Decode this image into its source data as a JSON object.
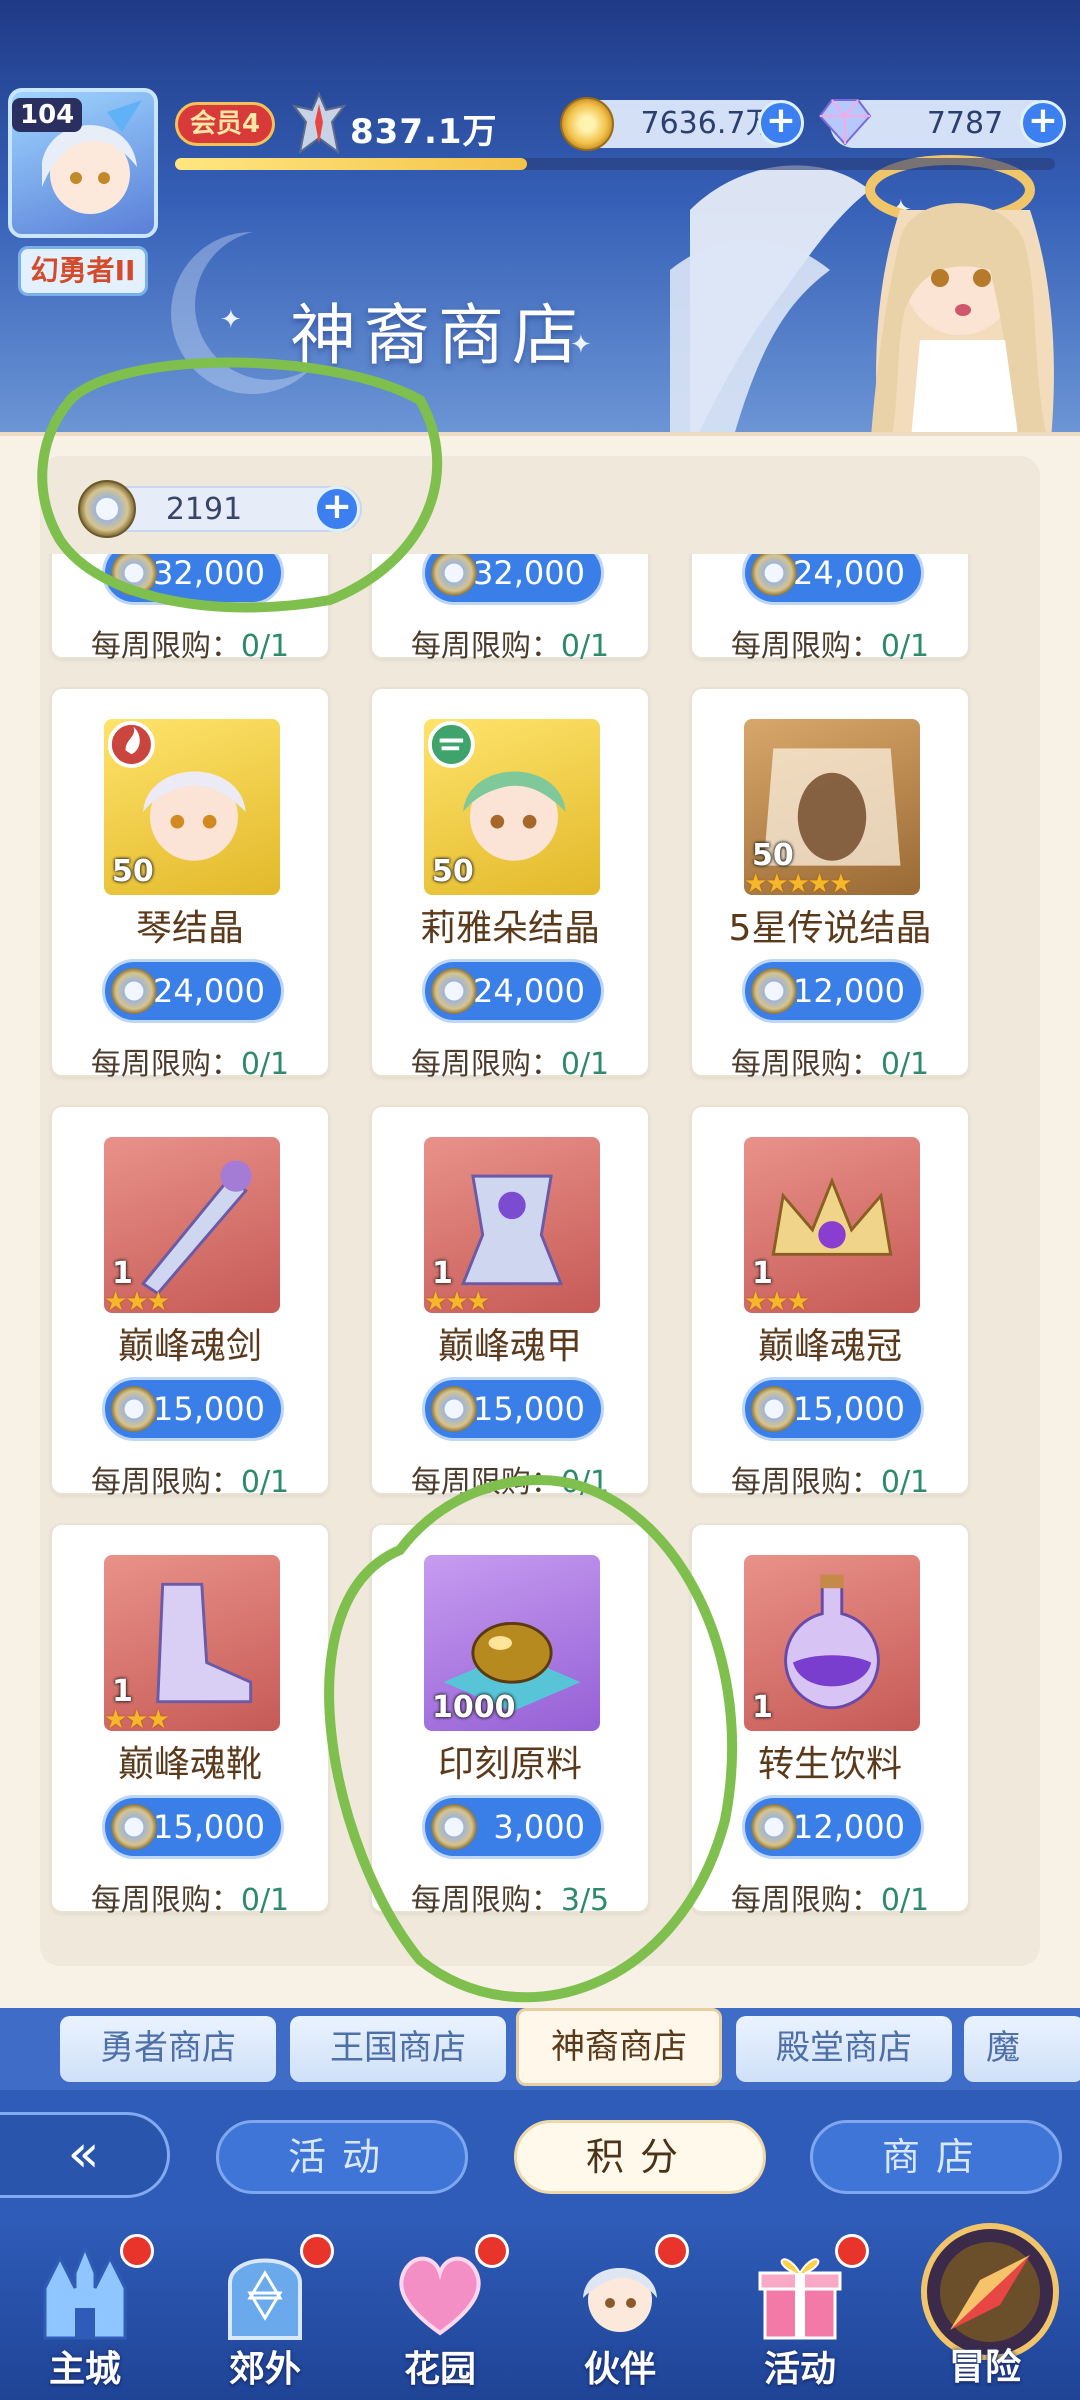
{
  "header": {
    "level": "104",
    "player_name": "幻勇者II",
    "vip": "会员4",
    "power": "837.1万",
    "gold": "7636.7万",
    "gems": "7787",
    "shop_title": "神裔商店",
    "exp_progress": 0.4
  },
  "currency": {
    "value": "2191"
  },
  "items": [
    {
      "name": "",
      "qty": "",
      "stars": 0,
      "price": "32,000",
      "limit_label": "每周限购：",
      "limit_value": "0/1",
      "thumb": "partial"
    },
    {
      "name": "",
      "qty": "",
      "stars": 0,
      "price": "32,000",
      "limit_label": "每周限购：",
      "limit_value": "0/1",
      "thumb": "partial"
    },
    {
      "name": "",
      "qty": "",
      "stars": 0,
      "price": "24,000",
      "limit_label": "每周限购：",
      "limit_value": "0/1",
      "thumb": "partial"
    },
    {
      "name": "琴结晶",
      "qty": "50",
      "stars": 0,
      "price": "24,000",
      "limit_label": "每周限购：",
      "limit_value": "0/1",
      "thumb": "gold-hero-red"
    },
    {
      "name": "莉雅朵结晶",
      "qty": "50",
      "stars": 0,
      "price": "24,000",
      "limit_label": "每周限购：",
      "limit_value": "0/1",
      "thumb": "gold-hero-green"
    },
    {
      "name": "5星传说结晶",
      "qty": "50",
      "stars": 5,
      "price": "12,000",
      "limit_label": "每周限购：",
      "limit_value": "0/1",
      "thumb": "bronze-crystal"
    },
    {
      "name": "巅峰魂剑",
      "qty": "1",
      "stars": 3,
      "price": "15,000",
      "limit_label": "每周限购：",
      "limit_value": "0/1",
      "thumb": "red-sword"
    },
    {
      "name": "巅峰魂甲",
      "qty": "1",
      "stars": 3,
      "price": "15,000",
      "limit_label": "每周限购：",
      "limit_value": "0/1",
      "thumb": "red-armor"
    },
    {
      "name": "巅峰魂冠",
      "qty": "1",
      "stars": 3,
      "price": "15,000",
      "limit_label": "每周限购：",
      "limit_value": "0/1",
      "thumb": "red-crown"
    },
    {
      "name": "巅峰魂靴",
      "qty": "1",
      "stars": 3,
      "price": "15,000",
      "limit_label": "每周限购：",
      "limit_value": "0/1",
      "thumb": "red-boots"
    },
    {
      "name": "印刻原料",
      "qty": "1000",
      "stars": 0,
      "price": "3,000",
      "limit_label": "每周限购：",
      "limit_value": "3/5",
      "thumb": "purple-egg"
    },
    {
      "name": "转生饮料",
      "qty": "1",
      "stars": 0,
      "price": "12,000",
      "limit_label": "每周限购：",
      "limit_value": "0/1",
      "thumb": "red-potion"
    }
  ],
  "tabs": [
    "勇者商店",
    "王国商店",
    "神裔商店",
    "殿堂商店",
    "魔"
  ],
  "categories": [
    "活动",
    "积分",
    "商店"
  ],
  "nav": [
    "主城",
    "郊外",
    "花园",
    "伙伴",
    "活动",
    "冒险"
  ],
  "colors": {
    "accent": "#3a7ee8",
    "panel": "#f7f1e6",
    "annotation": "#7fbf4d"
  }
}
